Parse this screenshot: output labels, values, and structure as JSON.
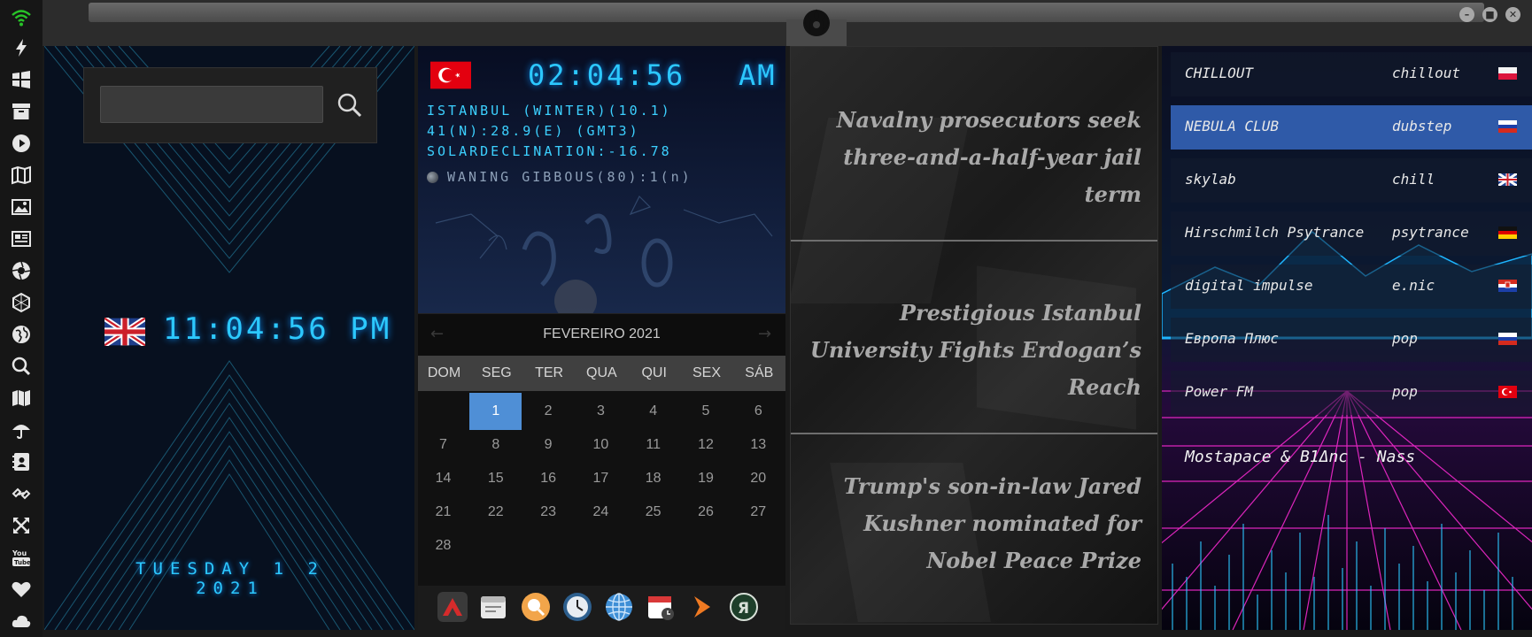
{
  "leftbar": {
    "icons": [
      "wifi-icon",
      "flash-icon",
      "windows-icon",
      "archive-icon",
      "play-icon",
      "map-book-icon",
      "image-icon",
      "news-icon",
      "aperture-icon",
      "hexagon-icon",
      "globe-icon",
      "search-icon",
      "map-icon",
      "umbrella-icon",
      "contacts-icon",
      "link-icon",
      "expand-icon",
      "youtube-icon",
      "heart-icon",
      "cloud-icon"
    ]
  },
  "window": {
    "minimize": "–",
    "maximize": "■",
    "close": "✕"
  },
  "search": {
    "value": "",
    "placeholder": ""
  },
  "london": {
    "time": "11:04:56  PM",
    "date": "TUESDAY 1 2 2021"
  },
  "istanbul": {
    "time": "02:04:56",
    "ampm": "AM",
    "line1": "ISTANBUL (WINTER)(10.1)",
    "line2": "41(N):28.9(E) (GMT3)",
    "line3": "SOLARDECLINATION:-16.78",
    "moon": "WANING GIBBOUS(80):1(n)"
  },
  "calendar": {
    "title": "FEVEREIRO 2021",
    "prev": "←",
    "next": "→",
    "days": [
      "DOM",
      "SEG",
      "TER",
      "QUA",
      "QUI",
      "SEX",
      "SÁB"
    ],
    "weeks": [
      [
        "",
        "1",
        "2",
        "3",
        "4",
        "5",
        "6"
      ],
      [
        "7",
        "8",
        "9",
        "10",
        "11",
        "12",
        "13"
      ],
      [
        "14",
        "15",
        "16",
        "17",
        "18",
        "19",
        "20"
      ],
      [
        "21",
        "22",
        "23",
        "24",
        "25",
        "26",
        "27"
      ],
      [
        "28",
        "",
        "",
        "",
        "",
        "",
        ""
      ]
    ],
    "today": "1",
    "colors": {
      "today": "#4f8fd6"
    }
  },
  "dock": {
    "icons": [
      "archive-app-icon",
      "calendar-notes-icon",
      "search-app-icon",
      "clock-app-icon",
      "globe-app-icon",
      "calendar-app-icon",
      "arrow-app-icon",
      "yandex-app-icon"
    ]
  },
  "news": [
    {
      "title": "Navalny prosecutors seek three-and-a-half-year jail term"
    },
    {
      "title": "Prestigious Istanbul University Fights Erdogan’s Reach"
    },
    {
      "title": "Trump's son-in-law Jared Kushner nominated for Nobel Peace Prize"
    }
  ],
  "radio": {
    "stations": [
      {
        "name": "CHILLOUT",
        "genre": "chillout",
        "flag": "poland",
        "active": false
      },
      {
        "name": "NEBULA CLUB",
        "genre": "dubstep",
        "flag": "russia",
        "active": true
      },
      {
        "name": "skylab",
        "genre": "chill",
        "flag": "uk",
        "active": false
      },
      {
        "name": "Hirschmilch Psytrance",
        "genre": "psytrance",
        "flag": "germany",
        "active": false
      },
      {
        "name": "digital impulse",
        "genre": "e.nic",
        "flag": "croatia",
        "active": false
      },
      {
        "name": "Европа Плюс",
        "genre": "pop",
        "flag": "russia",
        "active": false
      },
      {
        "name": "Power FM",
        "genre": "pop",
        "flag": "turkey",
        "active": false
      }
    ],
    "now_playing": "Mostapace & B1Δnc - Nass",
    "colors": {
      "active": "#2f5aa8",
      "accent": "#2cc8ff",
      "neon_pink": "#ff2bd6"
    }
  }
}
